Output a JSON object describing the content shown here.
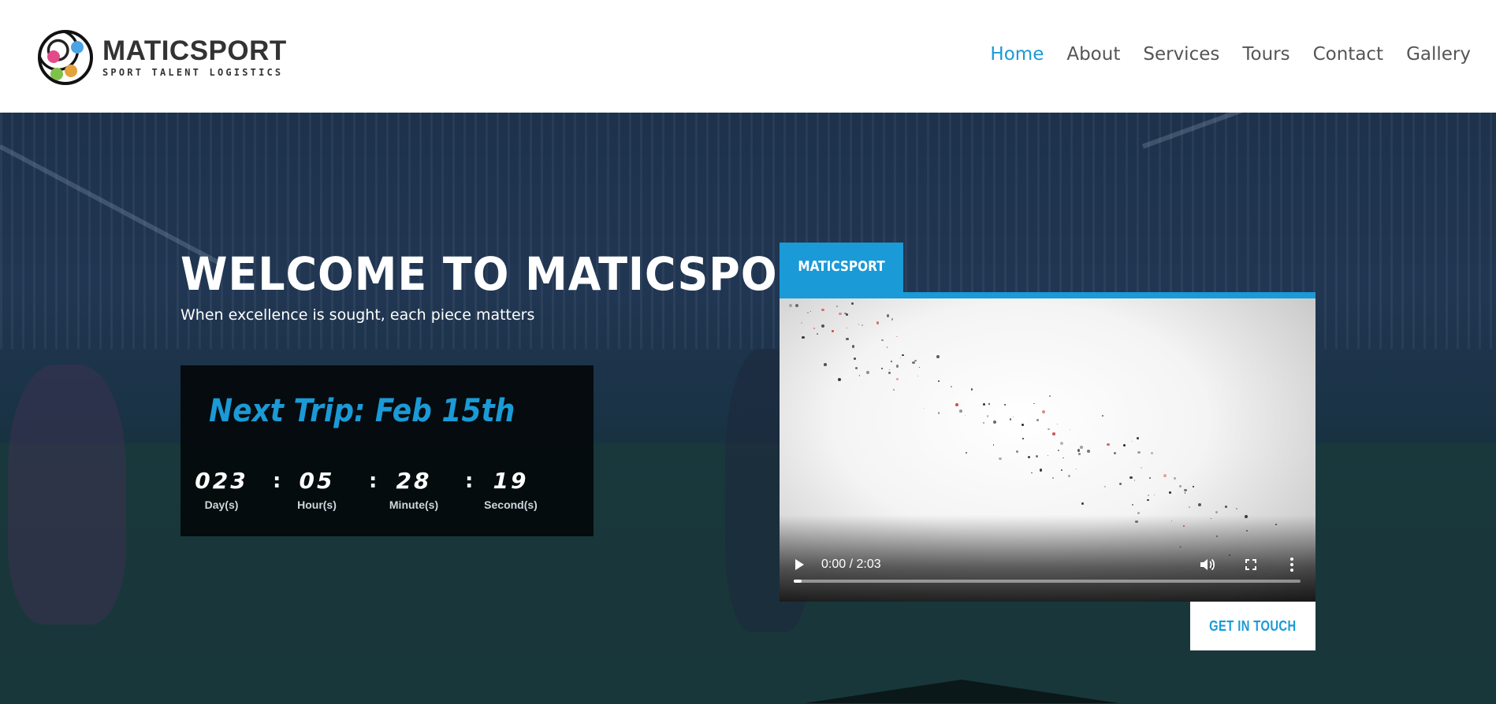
{
  "brand": {
    "name": "MATICSPORT",
    "tagline": "SPORT TALENT LOGISTICS",
    "accent_color": "#1a9ad6"
  },
  "nav": {
    "items": [
      {
        "label": "Home",
        "active": true
      },
      {
        "label": "About",
        "active": false
      },
      {
        "label": "Services",
        "active": false
      },
      {
        "label": "Tours",
        "active": false
      },
      {
        "label": "Contact",
        "active": false
      },
      {
        "label": "Gallery",
        "active": false
      }
    ]
  },
  "hero": {
    "title": "WELCOME TO MATICSPORT",
    "subtitle": "When excellence is sought, each piece matters"
  },
  "countdown": {
    "title": "Next Trip: Feb 15th",
    "separator": ":",
    "units": [
      {
        "value": "023",
        "label": "Day(s)"
      },
      {
        "value": "05",
        "label": "Hour(s)"
      },
      {
        "value": "28",
        "label": "Minute(s)"
      },
      {
        "value": "19",
        "label": "Second(s)"
      }
    ]
  },
  "video": {
    "tab_label": "MATICSPORT",
    "time_display": "0:00 / 2:03",
    "progress": 0.015,
    "icons": {
      "play": "play-icon",
      "volume": "volume-icon",
      "fullscreen": "fullscreen-icon",
      "more": "more-vertical-icon"
    }
  },
  "cta": {
    "label": "GET IN TOUCH"
  }
}
